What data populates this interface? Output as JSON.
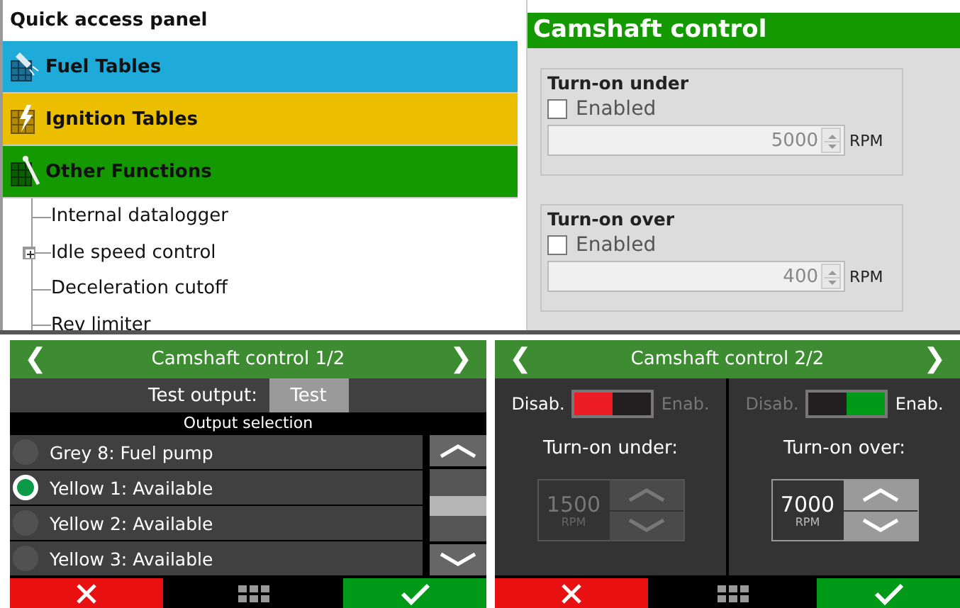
{
  "quick_access_panel": {
    "title": "Quick access panel",
    "categories": [
      {
        "label": "Fuel Tables",
        "color": "#1fabd9",
        "kind": "fuel"
      },
      {
        "label": "Ignition Tables",
        "color": "#ebbf00",
        "kind": "ignition"
      },
      {
        "label": "Other Functions",
        "color": "#149a00",
        "kind": "other"
      }
    ],
    "tree": [
      {
        "label": "Internal datalogger",
        "kind": "leaf"
      },
      {
        "label": "Idle speed control",
        "kind": "folder"
      },
      {
        "label": "Deceleration cutoff",
        "kind": "leaf"
      },
      {
        "label": "Rev limiter",
        "kind": "leaf"
      }
    ]
  },
  "camshaft_settings": {
    "title": "Camshaft control",
    "groups": [
      {
        "title": "Turn-on under",
        "checkbox_label": "Enabled",
        "checked": false,
        "value": "5000",
        "unit": "RPM",
        "disabled": true
      },
      {
        "title": "Turn-on over",
        "checkbox_label": "Enabled",
        "checked": false,
        "value": "400",
        "unit": "RPM",
        "disabled": true
      }
    ]
  },
  "screen_1": {
    "title": "Camshaft control 1/2",
    "prev": "❮",
    "next": "❯",
    "test_label": "Test output:",
    "test_button": "Test",
    "section": "Output selection",
    "outputs": [
      {
        "label": "Grey 8: Fuel pump",
        "selected": false
      },
      {
        "label": "Yellow 1: Available",
        "selected": true
      },
      {
        "label": "Yellow 2: Available",
        "selected": false
      },
      {
        "label": "Yellow 3: Available",
        "selected": false
      }
    ]
  },
  "screen_2": {
    "title": "Camshaft control 2/2",
    "prev": "❮",
    "next": "❯",
    "columns": [
      {
        "off_label": "Disab.",
        "on_label": "Enab.",
        "on": false,
        "label": "Turn-on under:",
        "value": "1500",
        "unit": "RPM",
        "disabled": true
      },
      {
        "off_label": "Disab.",
        "on_label": "Enab.",
        "on": true,
        "label": "Turn-on over:",
        "value": "7000",
        "unit": "RPM",
        "disabled": false
      }
    ]
  }
}
